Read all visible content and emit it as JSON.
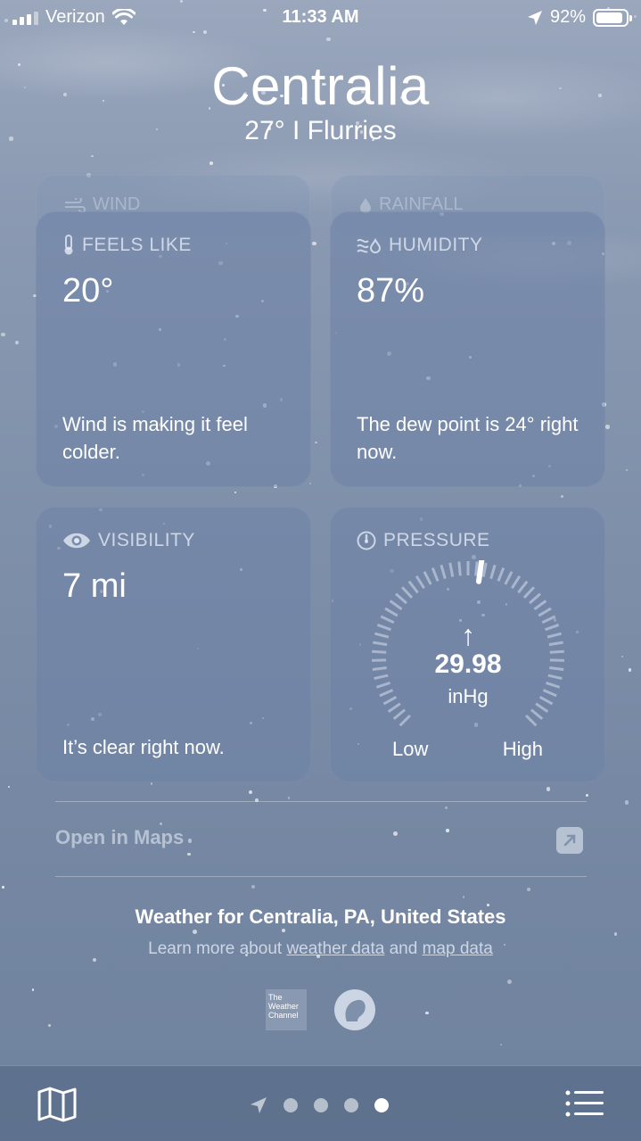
{
  "status": {
    "carrier": "Verizon",
    "time": "11:33 AM",
    "battery": "92%",
    "battery_level": 0.92
  },
  "header": {
    "city": "Centralia",
    "summary": "27°  I  Flurries"
  },
  "ghost_cards": {
    "left": "WIND",
    "right": "RAINFALL"
  },
  "cards": {
    "feels_like": {
      "label": "FEELS LIKE",
      "value": "20°",
      "note": "Wind is making it feel colder.",
      "icon": "thermometer-icon"
    },
    "humidity": {
      "label": "HUMIDITY",
      "value": "87%",
      "note": "The dew point is 24° right now.",
      "icon": "humidity-icon"
    },
    "visibility": {
      "label": "VISIBILITY",
      "value": "7 mi",
      "note": "It’s clear right now.",
      "icon": "eye-icon"
    },
    "pressure": {
      "label": "PRESSURE",
      "value": "29.98",
      "unit": "inHg",
      "trend": "↑",
      "low": "Low",
      "high": "High",
      "icon": "gauge-icon"
    }
  },
  "links": {
    "open_maps": "Open in Maps"
  },
  "footer": {
    "title": "Weather for Centralia, PA, United States",
    "learn_prefix": "Learn more about",
    "weather_data": "weather data",
    "and": "and",
    "map_data": "map data",
    "brand": "The Weather Channel"
  },
  "tabbar": {
    "page_count": 4,
    "active_page": 4
  },
  "colors": {
    "background": "#8b9ab2",
    "card": "#6e82a5",
    "text": "#ffffff"
  }
}
